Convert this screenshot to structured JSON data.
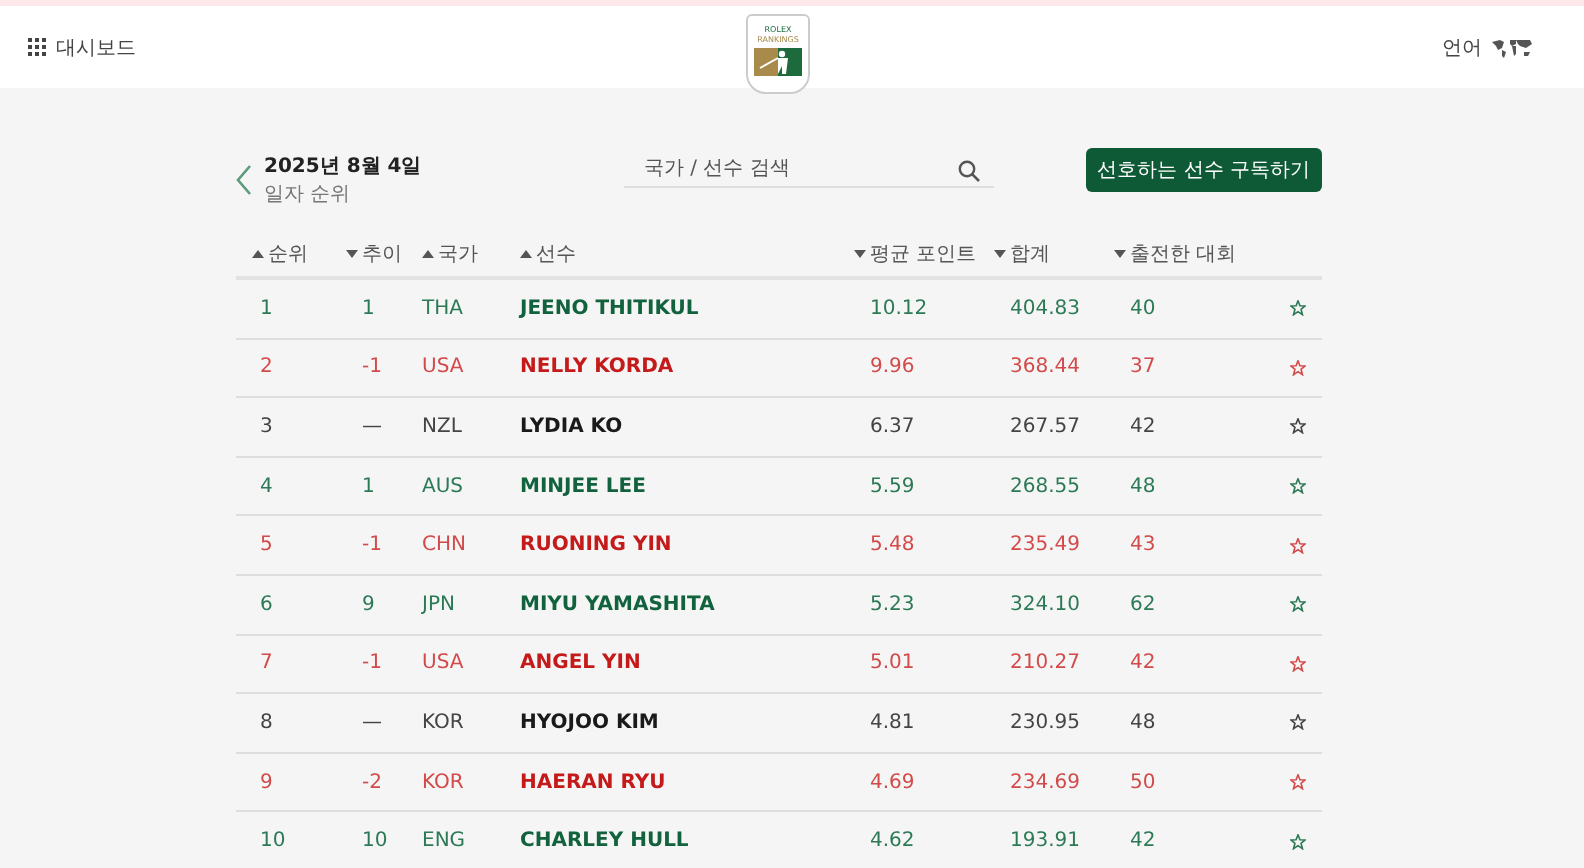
{
  "topbar": {
    "dashboard": "대시보드",
    "logo_top": "ROLEX",
    "logo_bottom": "RANKINGS",
    "language": "언어"
  },
  "date": {
    "title": "2025년 8월 4일",
    "subtitle": "일자 순위"
  },
  "search": {
    "placeholder": "국가 / 선수 검색"
  },
  "subscribe_button": "선호하는 선수 구독하기",
  "columns": [
    {
      "label": "순위",
      "ascending": true
    },
    {
      "label": "추이",
      "ascending": false
    },
    {
      "label": "국가",
      "ascending": true
    },
    {
      "label": "선수",
      "ascending": true
    },
    {
      "label": "평균 포인트",
      "ascending": false
    },
    {
      "label": "합계",
      "ascending": false
    },
    {
      "label": "출전한 대회",
      "ascending": false
    }
  ],
  "rows": [
    {
      "kind": "up",
      "rank": "1",
      "move": "1",
      "country": "THA",
      "player": "JEENO THITIKUL",
      "avg": "10.12",
      "total": "404.83",
      "events": "40"
    },
    {
      "kind": "down",
      "rank": "2",
      "move": "-1",
      "country": "USA",
      "player": "NELLY KORDA",
      "avg": "9.96",
      "total": "368.44",
      "events": "37"
    },
    {
      "kind": "none",
      "rank": "3",
      "move": "—",
      "country": "NZL",
      "player": "LYDIA KO",
      "avg": "6.37",
      "total": "267.57",
      "events": "42"
    },
    {
      "kind": "up",
      "rank": "4",
      "move": "1",
      "country": "AUS",
      "player": "MINJEE LEE",
      "avg": "5.59",
      "total": "268.55",
      "events": "48"
    },
    {
      "kind": "down",
      "rank": "5",
      "move": "-1",
      "country": "CHN",
      "player": "RUONING YIN",
      "avg": "5.48",
      "total": "235.49",
      "events": "43"
    },
    {
      "kind": "up",
      "rank": "6",
      "move": "9",
      "country": "JPN",
      "player": "MIYU YAMASHITA",
      "avg": "5.23",
      "total": "324.10",
      "events": "62"
    },
    {
      "kind": "down",
      "rank": "7",
      "move": "-1",
      "country": "USA",
      "player": "ANGEL YIN",
      "avg": "5.01",
      "total": "210.27",
      "events": "42"
    },
    {
      "kind": "none",
      "rank": "8",
      "move": "—",
      "country": "KOR",
      "player": "HYOJOO KIM",
      "avg": "4.81",
      "total": "230.95",
      "events": "48"
    },
    {
      "kind": "down",
      "rank": "9",
      "move": "-2",
      "country": "KOR",
      "player": "HAERAN RYU",
      "avg": "4.69",
      "total": "234.69",
      "events": "50"
    },
    {
      "kind": "up",
      "rank": "10",
      "move": "10",
      "country": "ENG",
      "player": "CHARLEY HULL",
      "avg": "4.62",
      "total": "193.91",
      "events": "42"
    }
  ]
}
